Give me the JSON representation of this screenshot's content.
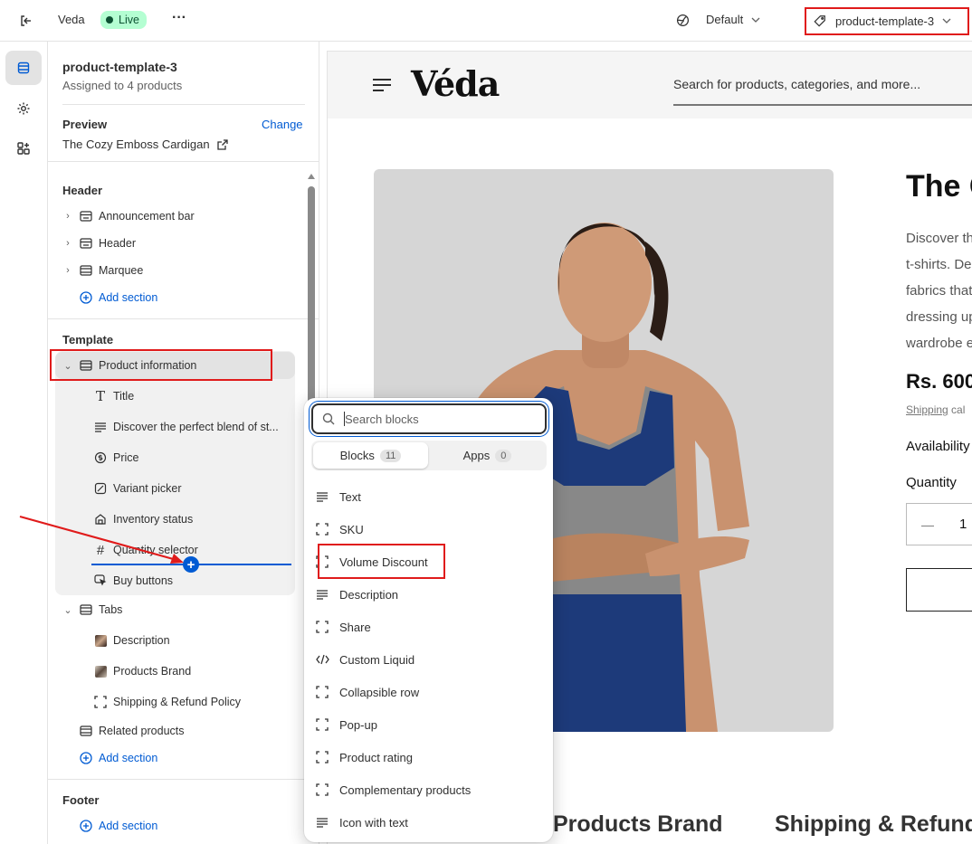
{
  "topbar": {
    "store_name": "Veda",
    "status": "Live",
    "more": "···",
    "theme_variant": "Default",
    "template": "product-template-3"
  },
  "sidebar": {
    "template_name": "product-template-3",
    "assigned": "Assigned to 4 products",
    "preview_label": "Preview",
    "change_label": "Change",
    "preview_product": "The Cozy Emboss Cardigan",
    "header_group": "Header",
    "header_items": [
      "Announcement bar",
      "Header",
      "Marquee"
    ],
    "add_section": "Add section",
    "template_group": "Template",
    "product_info": "Product information",
    "blocks": [
      "Title",
      "Discover the perfect blend of st...",
      "Price",
      "Variant picker",
      "Inventory status",
      "Quantity selector",
      "Buy buttons"
    ],
    "tabs": "Tabs",
    "tab_blocks": [
      "Description",
      "Products Brand",
      "Shipping & Refund Policy"
    ],
    "related": "Related products",
    "footer_group": "Footer"
  },
  "popover": {
    "search_placeholder": "Search blocks",
    "tab_blocks": "Blocks",
    "tab_blocks_count": "11",
    "tab_apps": "Apps",
    "tab_apps_count": "0",
    "items": [
      "Text",
      "SKU",
      "Volume Discount",
      "Description",
      "Share",
      "Custom Liquid",
      "Collapsible row",
      "Pop-up",
      "Product rating",
      "Complementary products",
      "Icon with text"
    ]
  },
  "preview": {
    "logo": "Véda",
    "search_placeholder": "Search for products, categories, and more...",
    "product_title": "The C",
    "desc_lines": [
      "Discover th",
      "t-shirts. Des",
      "fabrics that",
      "dressing up",
      "wardrobe e"
    ],
    "price": "Rs. 600",
    "shipping": "Shipping",
    "shipping_rest": " cal",
    "availability": "Availability",
    "quantity": "Quantity",
    "qty_minus": "—",
    "qty_value": "1",
    "tab_brand": "Products Brand",
    "tab_shipping": "Shipping & Refund"
  },
  "colors": {
    "accent": "#005bd3",
    "live_bg": "#b4fed2",
    "live_text": "#0c5132",
    "highlight": "#e01b1b"
  }
}
